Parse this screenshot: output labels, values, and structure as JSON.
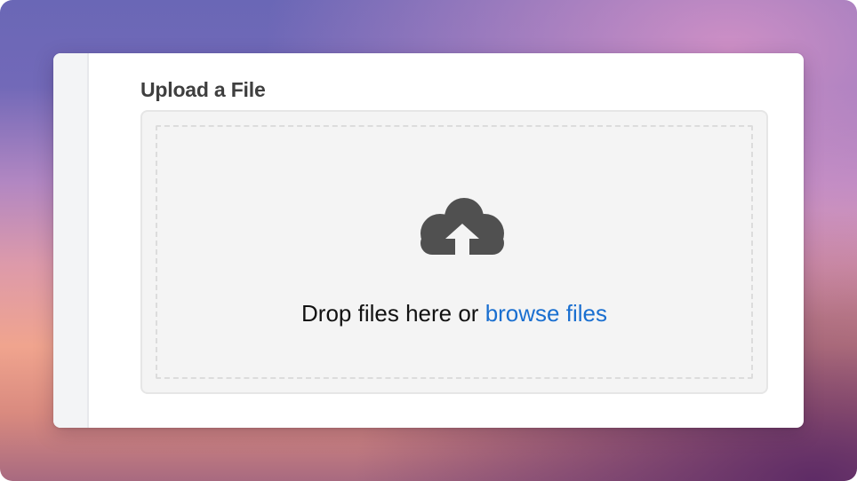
{
  "upload": {
    "title": "Upload a File",
    "drop_text": "Drop files here or",
    "browse_link": "browse files",
    "icon": "cloud-upload-icon"
  },
  "colors": {
    "link": "#1a6fd0",
    "icon": "#505050",
    "title": "#3f3f3f"
  }
}
